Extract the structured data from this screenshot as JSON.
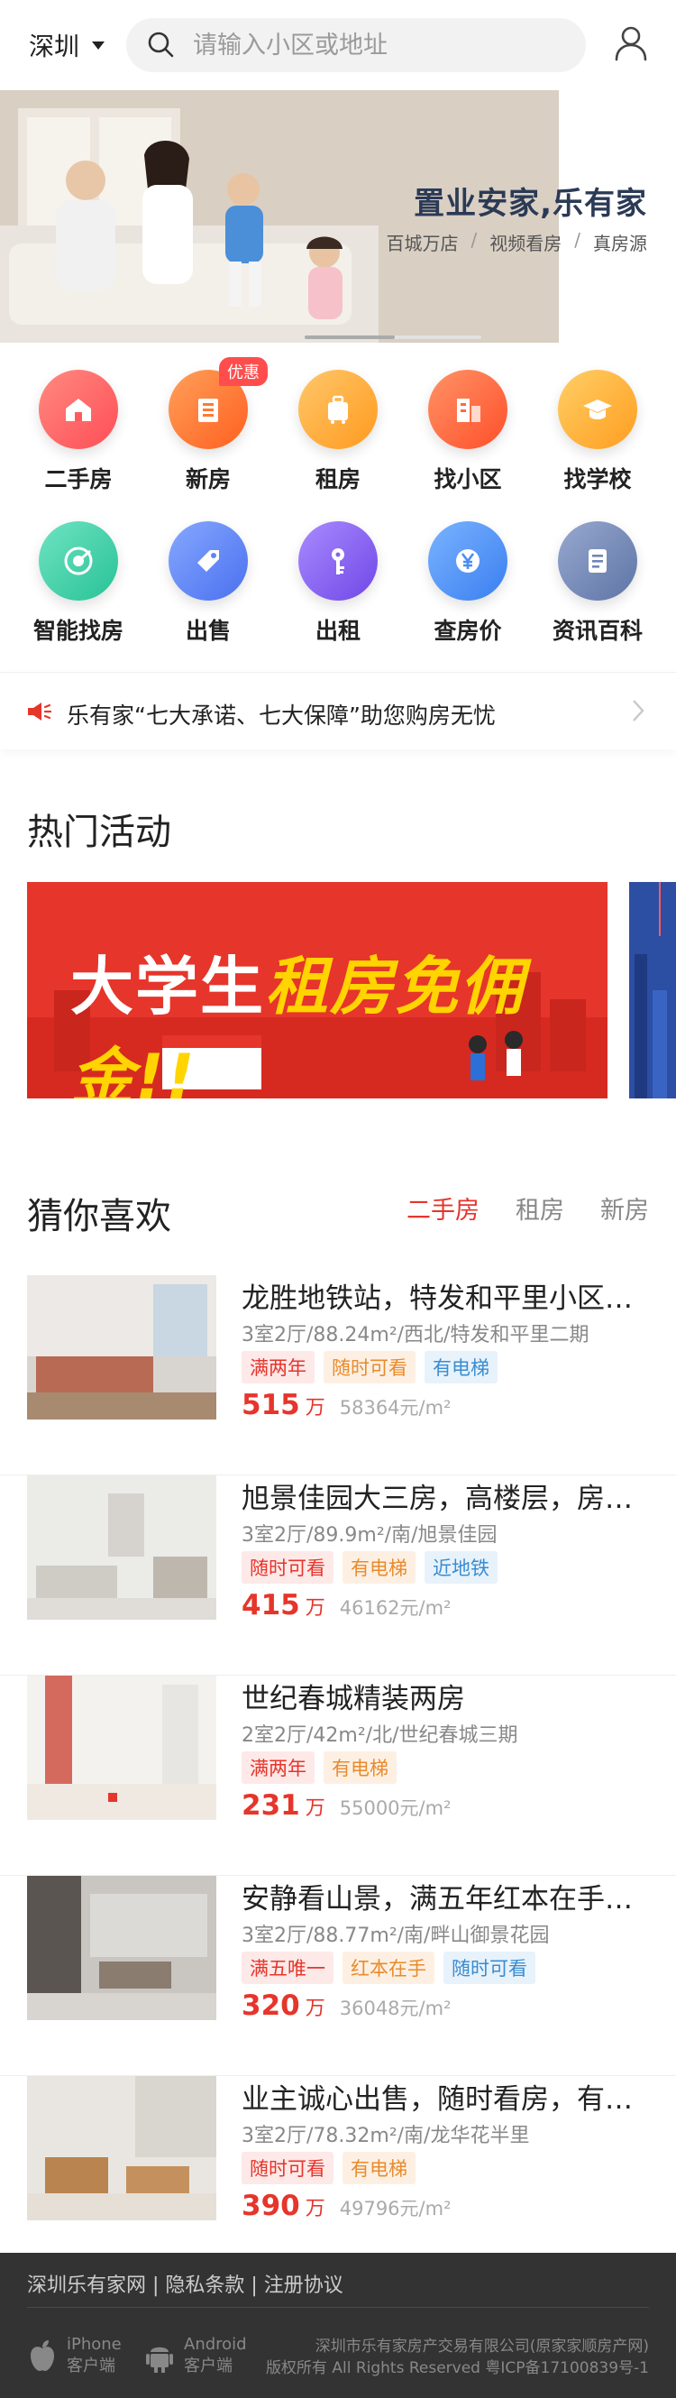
{
  "header": {
    "city": "深圳",
    "search_placeholder": "请输入小区或地址"
  },
  "banner": {
    "title": "置业安家,乐有家",
    "features": [
      "百城万店",
      "视频看房",
      "真房源"
    ],
    "separator": "/"
  },
  "quick_nav": [
    {
      "label": "二手房",
      "icon": "house-icon",
      "color": "#ff5a5f"
    },
    {
      "label": "新房",
      "icon": "building-icon",
      "color": "#ff7a2e",
      "badge": "优惠"
    },
    {
      "label": "租房",
      "icon": "suitcase-icon",
      "color": "#ffa531"
    },
    {
      "label": "找小区",
      "icon": "community-icon",
      "color": "#ff6b3d"
    },
    {
      "label": "找学校",
      "icon": "graduation-cap-icon",
      "color": "#ffb02e"
    },
    {
      "label": "智能找房",
      "icon": "radar-icon",
      "color": "#3ccfa8"
    },
    {
      "label": "出售",
      "icon": "price-tag-icon",
      "color": "#5b86f5"
    },
    {
      "label": "出租",
      "icon": "key-icon",
      "color": "#8a62f0"
    },
    {
      "label": "查房价",
      "icon": "yen-icon",
      "color": "#4a8df6"
    },
    {
      "label": "资讯百科",
      "icon": "document-icon",
      "color": "#6f86b8"
    }
  ],
  "notice": {
    "text": "乐有家“七大承诺、七大保障”助您购房无忧"
  },
  "hot_activities": {
    "title": "热门活动",
    "promo_text_white_1": "大学生",
    "promo_text_yellow": "租房免佣金!!"
  },
  "recommend": {
    "title": "猜你喜欢",
    "tabs": [
      "二手房",
      "租房",
      "新房"
    ],
    "active_tab": 0,
    "unit": "万",
    "listings": [
      {
        "title": "龙胜地铁站，特发和平里小区…",
        "meta": "3室2厅/88.24m²/西北/特发和平里二期",
        "tags": [
          {
            "text": "满两年",
            "color": "red"
          },
          {
            "text": "随时可看",
            "color": "orange"
          },
          {
            "text": "有电梯",
            "color": "blue"
          }
        ],
        "price": "515",
        "unit_price": "58364元/m²"
      },
      {
        "title": "旭景佳园大三房，高楼层，房…",
        "meta": "3室2厅/89.9m²/南/旭景佳园",
        "tags": [
          {
            "text": "随时可看",
            "color": "red"
          },
          {
            "text": "有电梯",
            "color": "orange"
          },
          {
            "text": "近地铁",
            "color": "blue"
          }
        ],
        "price": "415",
        "unit_price": "46162元/m²"
      },
      {
        "title": "世纪春城精装两房",
        "meta": "2室2厅/42m²/北/世纪春城三期",
        "tags": [
          {
            "text": "满两年",
            "color": "red"
          },
          {
            "text": "有电梯",
            "color": "orange"
          }
        ],
        "price": "231",
        "unit_price": "55000元/m²"
      },
      {
        "title": "安静看山景，满五年红本在手…",
        "meta": "3室2厅/88.77m²/南/畔山御景花园",
        "tags": [
          {
            "text": "满五唯一",
            "color": "red"
          },
          {
            "text": "红本在手",
            "color": "orange"
          },
          {
            "text": "随时可看",
            "color": "blue"
          }
        ],
        "price": "320",
        "unit_price": "36048元/m²"
      },
      {
        "title": "业主诚心出售，随时看房，有…",
        "meta": "3室2厅/78.32m²/南/龙华花半里",
        "tags": [
          {
            "text": "随时可看",
            "color": "red"
          },
          {
            "text": "有电梯",
            "color": "orange"
          }
        ],
        "price": "390",
        "unit_price": "49796元/m²"
      }
    ]
  },
  "footer": {
    "links": "深圳乐有家网 | 隐私条款 | 注册协议",
    "apps": [
      {
        "name": "iPhone",
        "sub": "客户端",
        "icon": "apple-icon"
      },
      {
        "name": "Android",
        "sub": "客户端",
        "icon": "android-icon"
      }
    ],
    "company": "深圳市乐有家房产交易有限公司(原家家顺房产网)",
    "rights": "版权所有 All Rights Reserved 粤ICP备17100839号-1"
  }
}
